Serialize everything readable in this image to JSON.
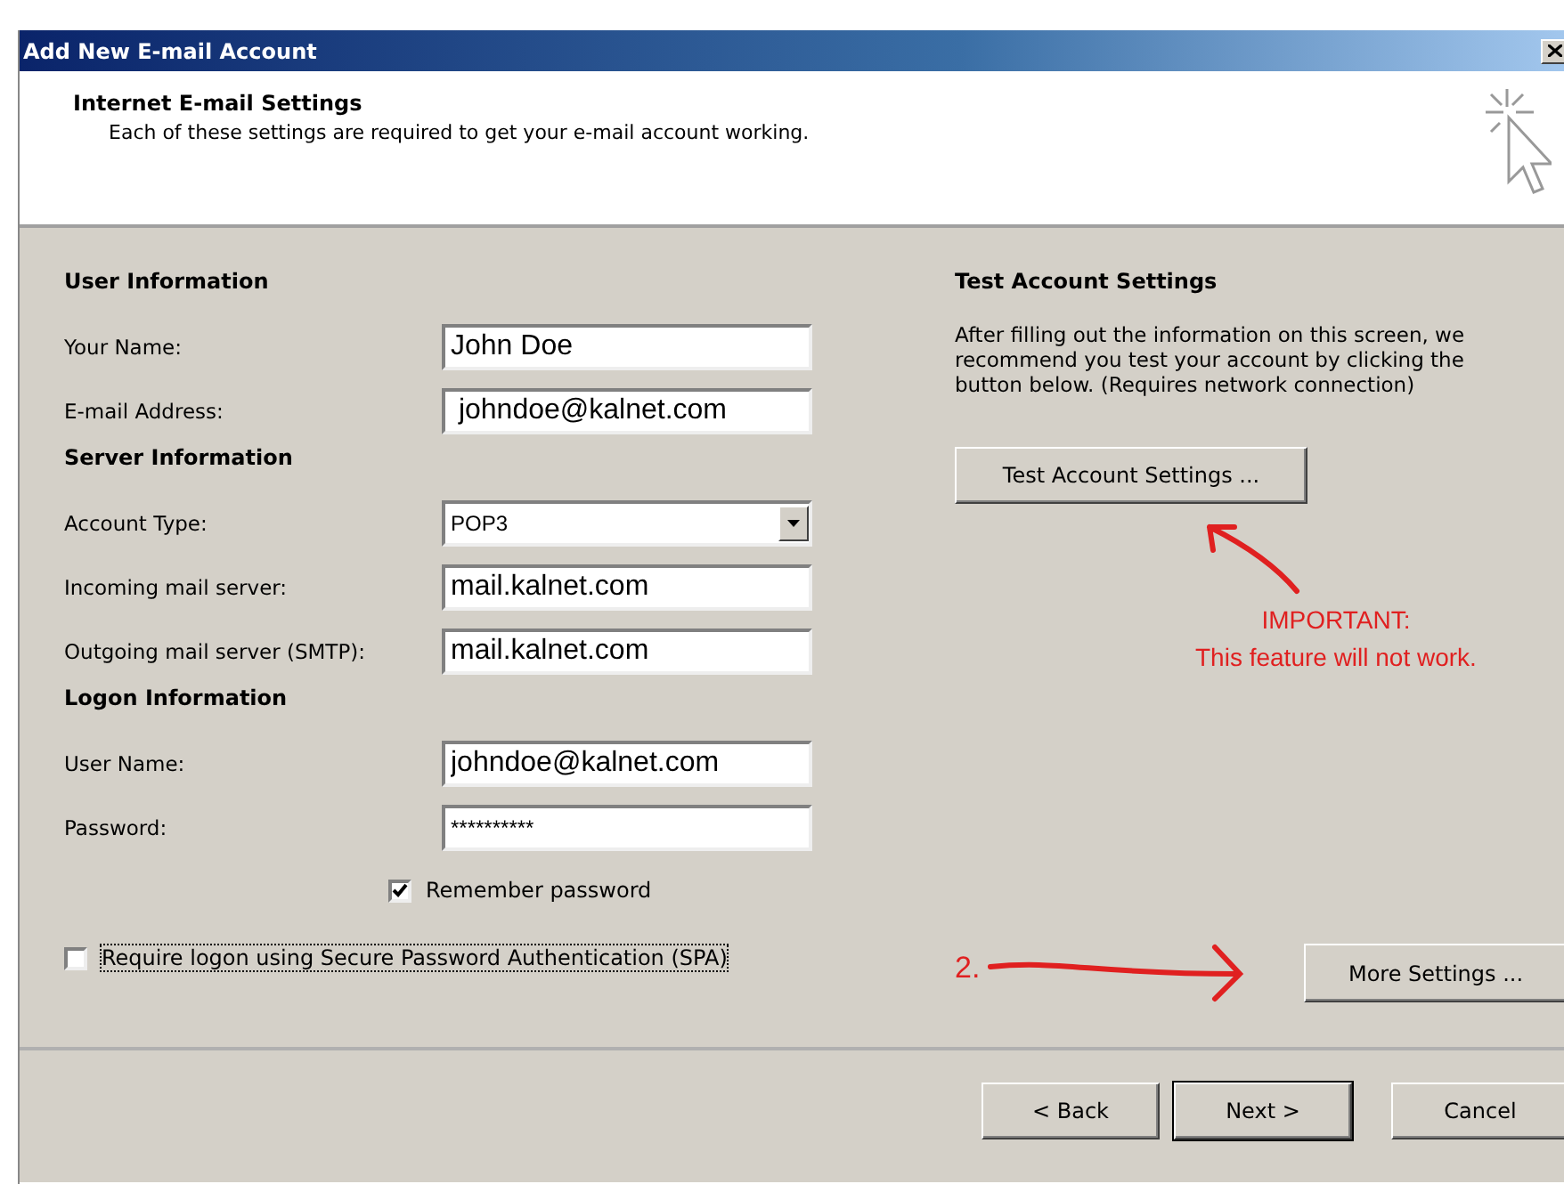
{
  "window": {
    "title": "Add New E-mail Account"
  },
  "header": {
    "title": "Internet E-mail Settings",
    "subtitle": "Each of these settings are required to get your e-mail account working."
  },
  "sections": [
    {
      "heading": "User Information",
      "fields": [
        {
          "kind": "text",
          "label": "Your Name:",
          "value": "John Doe"
        },
        {
          "kind": "text",
          "label": "E-mail Address:",
          "value": " johndoe@kalnet.com"
        }
      ]
    },
    {
      "heading": "Server Information",
      "fields": [
        {
          "kind": "select",
          "label": "Account Type:",
          "value": "POP3"
        },
        {
          "kind": "text",
          "label": "Incoming mail server:",
          "value": "mail.kalnet.com"
        },
        {
          "kind": "text",
          "label": "Outgoing mail server (SMTP):",
          "value": "mail.kalnet.com"
        }
      ]
    },
    {
      "heading": "Logon Information",
      "fields": [
        {
          "kind": "text",
          "label": "User Name:",
          "value": "johndoe@kalnet.com"
        },
        {
          "kind": "password",
          "label": "Password:",
          "value": "**********"
        }
      ]
    }
  ],
  "remember_password": {
    "label": "Remember password",
    "checked": true
  },
  "require_spa": {
    "label": "Require logon using Secure Password Authentication (SPA)",
    "checked": false
  },
  "test_panel": {
    "heading": "Test Account Settings",
    "text": "After filling out the information on this screen, we recommend you test your account by clicking the button below. (Requires network connection)",
    "button": "Test Account Settings ..."
  },
  "annotations": {
    "note": [
      "IMPORTANT:",
      "This feature will not work."
    ],
    "step": "2."
  },
  "more_settings_button": "More Settings ...",
  "footer_buttons": [
    {
      "label": "< Back",
      "default": false
    },
    {
      "label": "Next >",
      "default": true
    },
    {
      "label": "Cancel",
      "default": false
    }
  ]
}
